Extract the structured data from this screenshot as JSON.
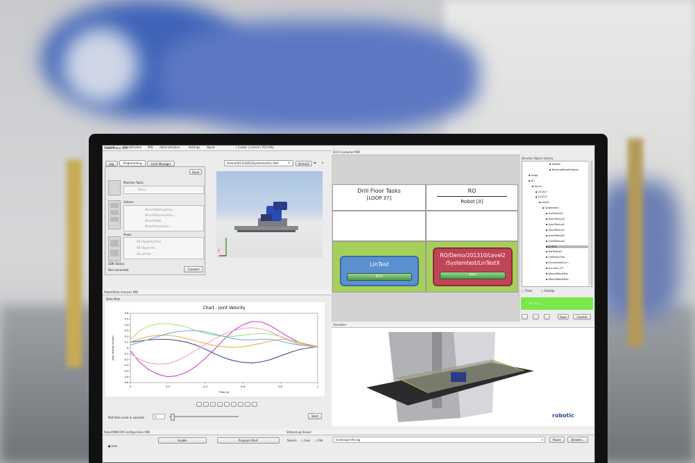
{
  "robot_mid": {
    "title": "Robot/Robot MID",
    "menu": [
      "Layout",
      "Identification",
      "MID",
      "Administration",
      "Settings",
      "About"
    ],
    "address": "| (nodes | control | RCS-MS)",
    "tabs": [
      "Jog",
      "Programming",
      "Limit Manager"
    ],
    "view_tab": "Demo/201310/RO/Systemtest/LinTest",
    "view_tab_2": "Demo/2",
    "send_label": "Send",
    "machine_tasks_label": "Machine Tasks",
    "machine_task_item": "Demo",
    "actions_label": "Actions",
    "actions": [
      "MoveToWaitingArea...",
      "MoveToRackAndPick...",
      "MoveToWell...",
      "MoveToHandover..."
    ],
    "poses_label": "Poses",
    "poses": [
      "RB NippleUp Pose",
      "RB Nipple Pos",
      "RB Lift Pos"
    ],
    "ddk_status_label": "DDK Status",
    "not_connected": "Not connected",
    "connect_label": "Connect"
  },
  "data_analysis": {
    "title": "Robot/Data Analysis MID",
    "data_plots_label": "Data Plots",
    "plot_time_label": "Plot time scale in seconds",
    "plot_time_value": "5",
    "start_label": "Start"
  },
  "chart_data": {
    "type": "line",
    "title": "Chart : Joint Velocity",
    "xlabel": "Time (s)",
    "ylabel": "Joint Velocity (m/sec)",
    "xlim": [
      0,
      1.0
    ],
    "ylim": [
      -0.6,
      0.6
    ],
    "xticks": [
      "0",
      "0.2",
      "0.4",
      "0.6",
      "0.8",
      "1"
    ],
    "yticks": [
      "0.6",
      "0.5",
      "0.4",
      "0.3",
      "0.2",
      "0.1",
      "0",
      "-0.1",
      "-0.2",
      "-0.3",
      "-0.4",
      "-0.5",
      "-0.6"
    ],
    "series": [
      {
        "color": "#d040c8",
        "x": [
          0,
          0.05,
          0.1,
          0.15,
          0.2,
          0.25,
          0.3,
          0.35,
          0.4,
          0.45,
          0.5,
          0.55,
          0.6,
          0.65,
          0.7,
          0.75,
          0.8,
          0.85,
          0.9,
          0.95,
          1.0
        ],
        "y": [
          -0.05,
          -0.25,
          -0.38,
          -0.46,
          -0.5,
          -0.48,
          -0.42,
          -0.32,
          -0.18,
          -0.02,
          0.15,
          0.3,
          0.4,
          0.46,
          0.45,
          0.38,
          0.28,
          0.18,
          0.1,
          0.05,
          0.02
        ]
      },
      {
        "color": "#4a4a88",
        "x": [
          0,
          0.05,
          0.1,
          0.15,
          0.2,
          0.25,
          0.3,
          0.35,
          0.4,
          0.45,
          0.5,
          0.55,
          0.6,
          0.65,
          0.7,
          0.75,
          0.8,
          0.85,
          0.9,
          0.95,
          1.0
        ],
        "y": [
          0.1,
          0.12,
          0.14,
          0.15,
          0.15,
          0.13,
          0.1,
          0.05,
          -0.02,
          -0.1,
          -0.17,
          -0.22,
          -0.25,
          -0.26,
          -0.24,
          -0.2,
          -0.14,
          -0.08,
          -0.03,
          0.0,
          0.02
        ]
      },
      {
        "color": "#e8b24a",
        "x": [
          0,
          0.05,
          0.1,
          0.15,
          0.2,
          0.25,
          0.3,
          0.35,
          0.4,
          0.45,
          0.5,
          0.55,
          0.6,
          0.65,
          0.7,
          0.75,
          0.8,
          0.85,
          0.9,
          0.95,
          1.0
        ],
        "y": [
          0.1,
          0.16,
          0.2,
          0.22,
          0.22,
          0.2,
          0.16,
          0.12,
          0.08,
          0.04,
          0.02,
          0.01,
          0.02,
          0.05,
          0.08,
          0.12,
          0.15,
          0.14,
          0.1,
          0.06,
          0.03
        ]
      },
      {
        "color": "#9de07a",
        "x": [
          0,
          0.05,
          0.1,
          0.15,
          0.2,
          0.25,
          0.3,
          0.35,
          0.4,
          0.45,
          0.5,
          0.55,
          0.6,
          0.65,
          0.7,
          0.75,
          0.8,
          0.85,
          0.9,
          0.95,
          1.0
        ],
        "y": [
          0.15,
          0.3,
          0.38,
          0.42,
          0.42,
          0.4,
          0.36,
          0.3,
          0.25,
          0.22,
          0.2,
          0.2,
          0.22,
          0.24,
          0.25,
          0.24,
          0.2,
          0.14,
          0.08,
          0.04,
          0.02
        ]
      },
      {
        "color": "#7aa8e0",
        "x": [
          0,
          0.05,
          0.1,
          0.15,
          0.2,
          0.25,
          0.3,
          0.35,
          0.4,
          0.45,
          0.5,
          0.55,
          0.6,
          0.65,
          0.7,
          0.75,
          0.8,
          0.85,
          0.9,
          0.95,
          1.0
        ],
        "y": [
          0.05,
          0.1,
          0.15,
          0.2,
          0.25,
          0.28,
          0.3,
          0.3,
          0.28,
          0.24,
          0.2,
          0.16,
          0.14,
          0.14,
          0.15,
          0.15,
          0.12,
          0.08,
          0.05,
          0.03,
          0.02
        ]
      },
      {
        "color": "#f0a0c8",
        "x": [
          0,
          0.05,
          0.1,
          0.15,
          0.2,
          0.25,
          0.3,
          0.35,
          0.4,
          0.45,
          0.5,
          0.55,
          0.6,
          0.65,
          0.7,
          0.75,
          0.8,
          0.85,
          0.9,
          0.95,
          1.0
        ],
        "y": [
          -0.1,
          -0.2,
          -0.26,
          -0.28,
          -0.27,
          -0.22,
          -0.14,
          -0.04,
          0.06,
          0.16,
          0.24,
          0.3,
          0.34,
          0.35,
          0.33,
          0.28,
          0.2,
          0.12,
          0.06,
          0.03,
          0.01
        ]
      }
    ]
  },
  "drill_conductor": {
    "title": "Drill Conductor MID",
    "col1_header": "Drill Floor Tasks",
    "col1_sub": "[LOOP 37]",
    "col2_header": "RO",
    "col2_sub": "Robot [0]",
    "task1_label": "LinTest",
    "task1_progress": "95%",
    "task2_label_1": "RO/Demo/201310/Level2",
    "task2_label_2": "/Systemtest/LinTestX",
    "task2_progress": "95%",
    "colors": {
      "green": "#a6cf5a",
      "blue_box": "#5a8fd0",
      "red_box": "#c04458"
    }
  },
  "director": {
    "title": "Director Object Library",
    "tree": [
      "TestWC",
      "WorkingRangeGripper",
      "jdrigg",
      "RO",
      "Demo",
      "201307",
      "201310",
      "Level2",
      "Systemtest",
      "AxisTestLoi2",
      "Axis2TestLoi2",
      "Axis3TestLoi2",
      "Axis4TestLoi2",
      "Axis5TestLoi2",
      "Axis6TestLoi2",
      "LinTest",
      "RotTestLoi2",
      "1000HourTest",
      "AccelerationLim...",
      "Accuracy_PT",
      "AttachRobotTest",
      "AttachRobotTest..."
    ],
    "track_label": "Track",
    "gravity_label": "Gravity",
    "status_text": "Running",
    "save_label": "Save",
    "control_label": "Control"
  },
  "visualizer": {
    "title": "Visualizer",
    "logo": "robotic"
  },
  "bottom": {
    "nmcom_title": "Robot/NMCOM Configuration MID",
    "enable_label": "Enable",
    "program_start_label": "Program Start",
    "live_label": "Live",
    "statuslog_title": "Status/Log Viewer",
    "source_label": "Source",
    "file_label": "File",
    "file_value": "localcoop-info.log",
    "pause_label": "Pause",
    "browse_label": "Browse..."
  }
}
